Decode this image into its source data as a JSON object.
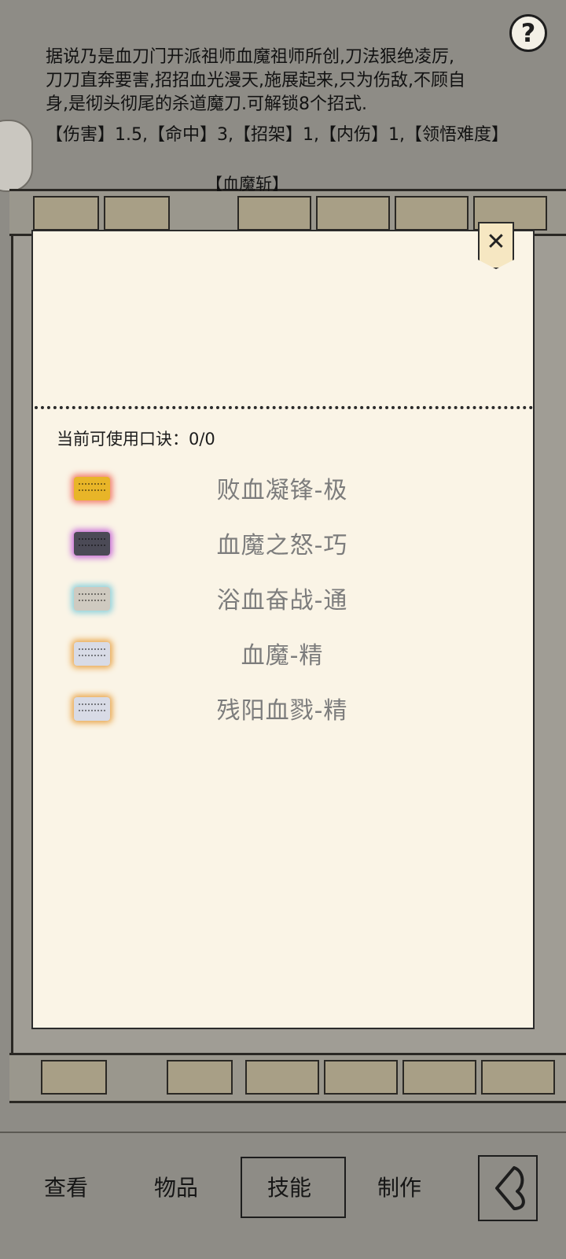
{
  "help": {
    "icon": "question-icon",
    "label": "?"
  },
  "description": {
    "lines": [
      "据说乃是血刀门开派祖师血魔祖师所创,刀法狠绝凌厉,",
      "刀刀直奔要害,招招血光漫天,施展起来,只为伤敌,不顾自",
      "身,是彻头彻尾的杀道魔刀.可解锁8个招式."
    ],
    "stats": "【伤害】1.5,【命中】3,【招架】1,【内伤】1,【领悟难度】",
    "move": "【血魔斩】"
  },
  "panel": {
    "close_icon": "close-icon",
    "close_label": "✕",
    "koujue_label": "当前可使用口诀：0/0",
    "skills": [
      {
        "name": "败血凝锋-极",
        "gem": "gold"
      },
      {
        "name": "血魔之怒-巧",
        "gem": "dark"
      },
      {
        "name": "浴血奋战-通",
        "gem": "teal"
      },
      {
        "name": "血魔-精",
        "gem": "silver"
      },
      {
        "name": "残阳血戮-精",
        "gem": "silver"
      }
    ]
  },
  "nav": {
    "items": [
      "查看",
      "物品",
      "技能",
      "制作"
    ],
    "active": "技能",
    "back_icon": "back-arrow-icon"
  }
}
